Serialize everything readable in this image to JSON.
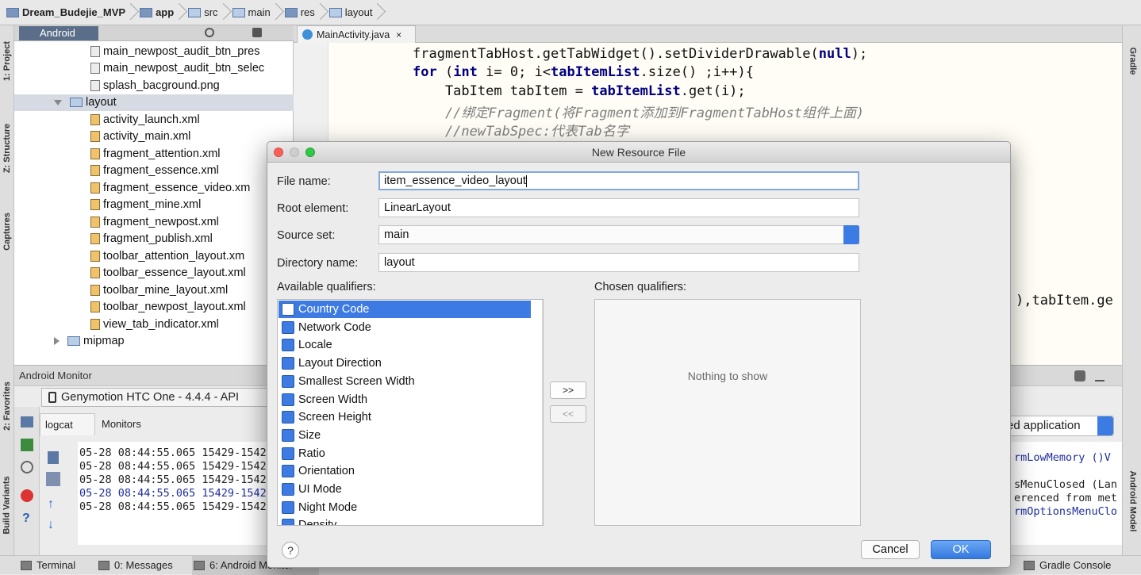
{
  "breadcrumb": [
    "Dream_Budejie_MVP",
    "app",
    "src",
    "main",
    "res",
    "layout"
  ],
  "left_tool_tabs": [
    "1: Project",
    "Z: Structure",
    "Captures",
    "2: Favorites",
    "Build Variants"
  ],
  "right_tool_tabs": [
    "Gradle",
    "Android Model"
  ],
  "project": {
    "view_selector": "Android",
    "items": [
      {
        "label": "main_newpost_audit_btn_pres",
        "type": "png",
        "indent": 1
      },
      {
        "label": "main_newpost_audit_btn_selec",
        "type": "png",
        "indent": 1
      },
      {
        "label": "splash_bacground.png",
        "type": "png",
        "indent": 1
      },
      {
        "label": "layout",
        "type": "folder",
        "indent": 0,
        "expanded": true,
        "selected": true
      },
      {
        "label": "activity_launch.xml",
        "type": "xml",
        "indent": 1
      },
      {
        "label": "activity_main.xml",
        "type": "xml",
        "indent": 1
      },
      {
        "label": "fragment_attention.xml",
        "type": "xml",
        "indent": 1
      },
      {
        "label": "fragment_essence.xml",
        "type": "xml",
        "indent": 1
      },
      {
        "label": "fragment_essence_video.xm",
        "type": "xml",
        "indent": 1
      },
      {
        "label": "fragment_mine.xml",
        "type": "xml",
        "indent": 1
      },
      {
        "label": "fragment_newpost.xml",
        "type": "xml",
        "indent": 1
      },
      {
        "label": "fragment_publish.xml",
        "type": "xml",
        "indent": 1
      },
      {
        "label": "toolbar_attention_layout.xm",
        "type": "xml",
        "indent": 1
      },
      {
        "label": "toolbar_essence_layout.xml",
        "type": "xml",
        "indent": 1
      },
      {
        "label": "toolbar_mine_layout.xml",
        "type": "xml",
        "indent": 1
      },
      {
        "label": "toolbar_newpost_layout.xml",
        "type": "xml",
        "indent": 1
      },
      {
        "label": "view_tab_indicator.xml",
        "type": "xml",
        "indent": 1
      },
      {
        "label": "mipmap",
        "type": "folder",
        "indent": 0,
        "expanded": false
      }
    ]
  },
  "editor": {
    "tab": "MainActivity.java",
    "lines": [
      [
        {
          "t": "fragmentTabHost.getTabWidget().setDividerDrawable(",
          "c": ""
        },
        {
          "t": "null",
          "c": "kw"
        },
        {
          "t": ");",
          "c": ""
        }
      ],
      [
        {
          "t": "for",
          "c": "kw"
        },
        {
          "t": " (",
          "c": ""
        },
        {
          "t": "int",
          "c": "kw"
        },
        {
          "t": " i= 0; i<",
          "c": ""
        },
        {
          "t": "tabItemList",
          "c": "kw"
        },
        {
          "t": ".size() ;i++){",
          "c": ""
        }
      ],
      [
        {
          "t": "    TabItem tabItem = ",
          "c": ""
        },
        {
          "t": "tabItemList",
          "c": "kw"
        },
        {
          "t": ".get(i);",
          "c": ""
        }
      ],
      [
        {
          "t": "    //绑定Fragment(将Fragment添加到FragmentTabHost组件上面)",
          "c": "cm"
        }
      ],
      [
        {
          "t": "    //newTabSpec:代表Tab名字",
          "c": "cm"
        }
      ]
    ],
    "overflow_right": "),tabItem.ge"
  },
  "monitor": {
    "header": "Android Monitor",
    "device": "Genymotion HTC One - 4.4.4 - API",
    "tabs": [
      "logcat",
      "Monitors"
    ],
    "app_filter": "ed application",
    "log_lines": [
      {
        "text": "05-28 08:44:55.065 15429-1542",
        "blue": false
      },
      {
        "text": "05-28 08:44:55.065 15429-1542",
        "blue": false
      },
      {
        "text": "05-28 08:44:55.065 15429-1542",
        "blue": false
      },
      {
        "text": "05-28 08:44:55.065 15429-1542",
        "blue": true
      },
      {
        "text": "05-28 08:44:55.065 15429-1542",
        "blue": false
      }
    ],
    "right_log": [
      {
        "text": "rmLowMemory ()V",
        "blue": true
      },
      {
        "text": "",
        "blue": false
      },
      {
        "text": "sMenuClosed (Lan",
        "blue": false
      },
      {
        "text": "erenced from met",
        "blue": false
      },
      {
        "text": "rmOptionsMenuClo",
        "blue": true
      }
    ]
  },
  "bottom_tabs": [
    "Terminal",
    "0: Messages",
    "6: Android Monitor",
    "Gradle Console"
  ],
  "dialog": {
    "title": "New Resource File",
    "fields": {
      "file_name_label": "File name:",
      "file_name_value": "item_essence_video_layout",
      "root_element_label": "Root element:",
      "root_element_value": "LinearLayout",
      "source_set_label": "Source set:",
      "source_set_value": "main",
      "directory_label": "Directory name:",
      "directory_value": "layout"
    },
    "available_label": "Available qualifiers:",
    "chosen_label": "Chosen qualifiers:",
    "qualifiers": [
      "Country Code",
      "Network Code",
      "Locale",
      "Layout Direction",
      "Smallest Screen Width",
      "Screen Width",
      "Screen Height",
      "Size",
      "Ratio",
      "Orientation",
      "UI Mode",
      "Night Mode",
      "Density"
    ],
    "selected_qualifier": "Country Code",
    "empty_text": "Nothing to show",
    "add_button": ">>",
    "remove_button": "<<",
    "help_button": "?",
    "cancel_button": "Cancel",
    "ok_button": "OK"
  },
  "colors": {
    "selection": "#3d7be2",
    "keyword": "#000080",
    "comment": "#808080",
    "ok_button": "#3479e0"
  }
}
